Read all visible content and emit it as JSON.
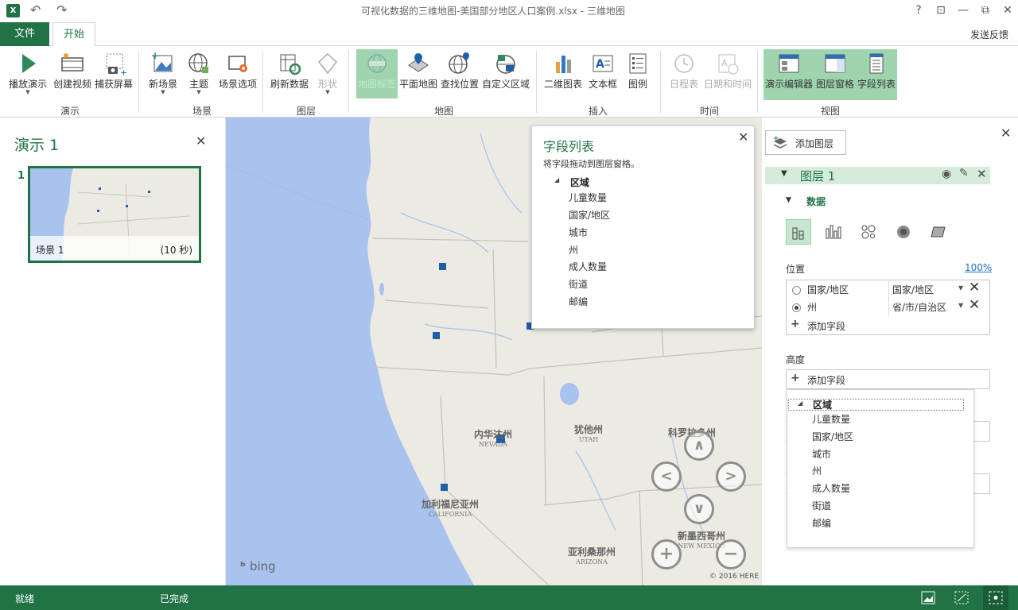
{
  "window": {
    "title": "可视化数据的三维地图-美国部分地区人口案例.xlsx - 三维地图",
    "app_icon_text": "X",
    "help": "?",
    "controls": [
      "⊡",
      "—",
      "⧉",
      "✕"
    ]
  },
  "tabs": {
    "file": "文件",
    "home": "开始",
    "feedback": "发送反馈"
  },
  "ribbon": {
    "buttons": {
      "play_tour": "播放演示",
      "create_video": "创建视频",
      "capture_screen": "捕获屏幕",
      "new_scene": "新场景",
      "themes": "主题",
      "scene_options": "场景选项",
      "refresh_data": "刷新数据",
      "shapes": "形状",
      "map_labels": "地图标签",
      "flat_map": "平面地图",
      "find_location": "查找位置",
      "custom_regions": "自定义区域",
      "chart_2d": "二维图表",
      "text_box": "文本框",
      "legend": "图例",
      "timeline": "日程表",
      "date_time": "日期和时间",
      "tour_editor": "演示编辑器",
      "layer_pane": "图层窗格",
      "field_list": "字段列表"
    },
    "groups": {
      "tour": "演示",
      "scene": "场景",
      "layer": "图层",
      "map": "地图",
      "insert": "插入",
      "time": "时间",
      "view": "视图"
    }
  },
  "tour_pane": {
    "title": "演示 1",
    "scene_number": "1",
    "scene_name": "场景 1",
    "scene_duration": "(10 秒)"
  },
  "map": {
    "labels": {
      "nevada": "内华达州",
      "nevada_en": "NEVADA",
      "utah": "犹他州",
      "utah_en": "UTAH",
      "colorado": "科罗拉多州",
      "california": "加利福尼亚州",
      "california_en": "CALIFORNIA",
      "arizona": "亚利桑那州",
      "arizona_en": "ARIZONA",
      "new_mexico": "新墨西哥州",
      "new_mexico_en": "NEW MEXICO"
    },
    "bing": "bing",
    "copyright": "© 2016 HERE"
  },
  "field_list": {
    "title": "字段列表",
    "subtitle": "将字段拖动到图层窗格。",
    "section": "区域",
    "fields": [
      "儿童数量",
      "国家/地区",
      "城市",
      "州",
      "成人数量",
      "街道",
      "邮编"
    ]
  },
  "layer_pane": {
    "add_layer": "添加图层",
    "layer_name": "图层 1",
    "data_heading": "数据",
    "location_label": "位置",
    "location_pct": "100%",
    "location_rows": [
      {
        "field": "国家/地区",
        "type": "国家/地区",
        "selected": false
      },
      {
        "field": "州",
        "type": "省/市/自治区",
        "selected": true
      }
    ],
    "add_field": "添加字段",
    "height_label": "高度",
    "dropdown_section": "区域",
    "dropdown_fields": [
      "儿童数量",
      "国家/地区",
      "城市",
      "州",
      "成人数量",
      "街道",
      "邮编"
    ]
  },
  "status": {
    "ready": "就绪",
    "done": "已完成"
  },
  "colors": {
    "accent": "#217346",
    "selected_button": "#9ed4ae",
    "data_point": "#1f5ea8",
    "water": "#a8c4ee"
  }
}
